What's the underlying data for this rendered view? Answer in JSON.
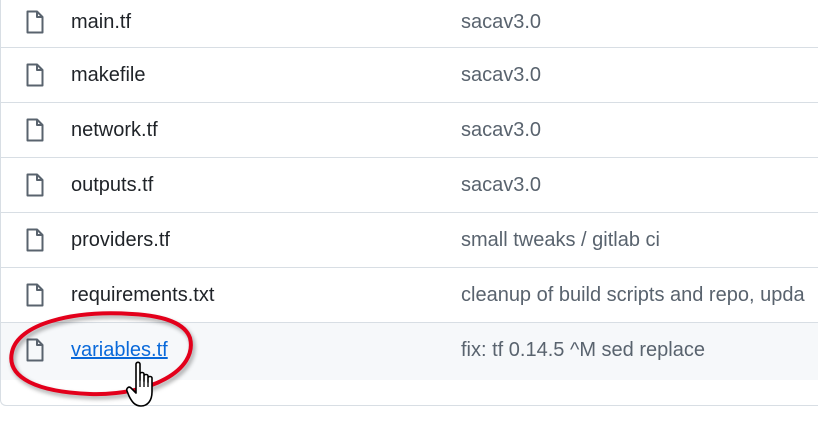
{
  "files": [
    {
      "name": "main.tf",
      "commit": "sacav3.0"
    },
    {
      "name": "makefile",
      "commit": "sacav3.0"
    },
    {
      "name": "network.tf",
      "commit": "sacav3.0"
    },
    {
      "name": "outputs.tf",
      "commit": "sacav3.0"
    },
    {
      "name": "providers.tf",
      "commit": "small tweaks / gitlab ci"
    },
    {
      "name": "requirements.txt",
      "commit": "cleanup of build scripts and repo, upda"
    },
    {
      "name": "variables.tf",
      "commit": "fix: tf 0.14.5 ^M sed replace"
    }
  ],
  "colors": {
    "link": "#0969da",
    "annotation": "#e3001b",
    "hover_row": "#f6f8fa",
    "border": "#d8dee4"
  },
  "icons": {
    "file": "file-icon",
    "cursor": "hand-pointer-cursor-icon"
  }
}
